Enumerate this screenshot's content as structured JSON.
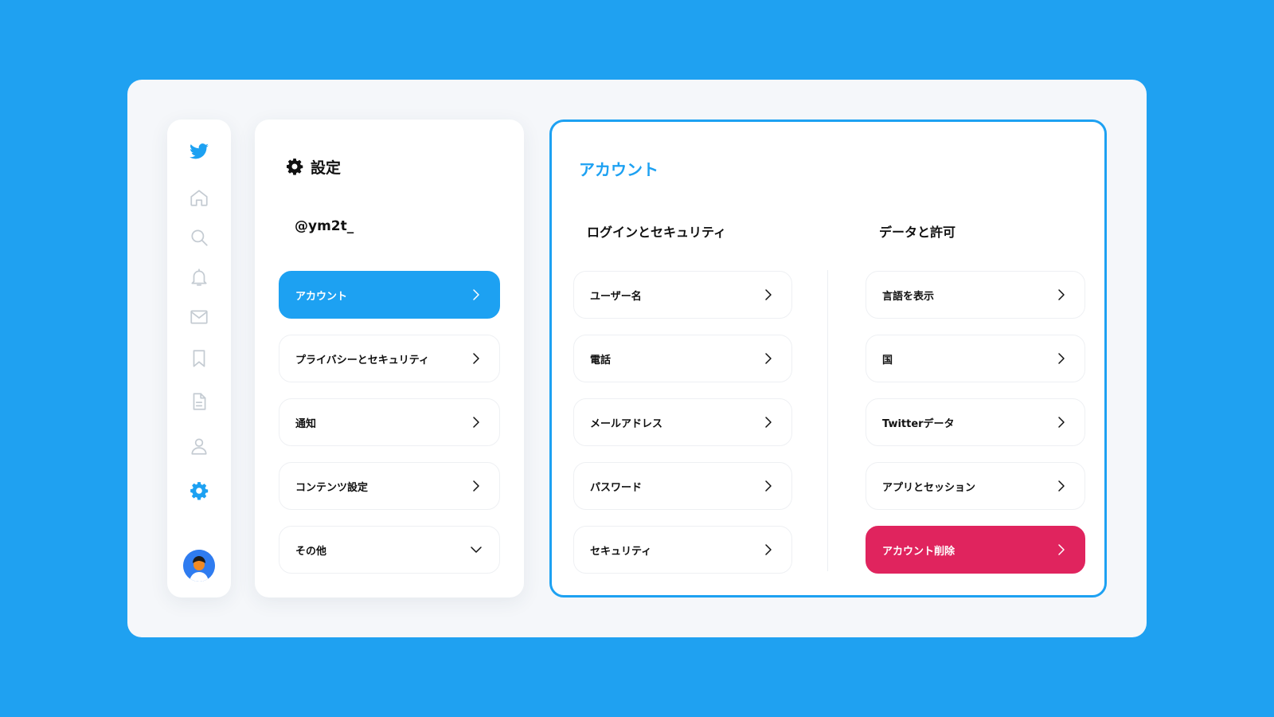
{
  "nav": {
    "logo_icon": "twitter-bird-icon",
    "items": [
      {
        "icon": "home-icon"
      },
      {
        "icon": "search-icon"
      },
      {
        "icon": "bell-icon"
      },
      {
        "icon": "mail-icon"
      },
      {
        "icon": "bookmark-icon"
      },
      {
        "icon": "document-icon"
      },
      {
        "icon": "profile-icon"
      },
      {
        "icon": "gear-icon",
        "active": true
      }
    ],
    "avatar_icon": "avatar"
  },
  "settings": {
    "title": "設定",
    "handle": "@ym2t_",
    "items": [
      {
        "label": "アカウント",
        "active": true
      },
      {
        "label": "プライバシーとセキュリティ"
      },
      {
        "label": "通知"
      },
      {
        "label": "コンテンツ設定"
      },
      {
        "label": "その他",
        "indicator": "chevron-down"
      }
    ]
  },
  "account": {
    "title": "アカウント",
    "login_security": {
      "heading": "ログインとセキュリティ",
      "items": [
        {
          "label": "ユーザー名"
        },
        {
          "label": "電話"
        },
        {
          "label": "メールアドレス"
        },
        {
          "label": "パスワード"
        },
        {
          "label": "セキュリティ"
        }
      ]
    },
    "data_permissions": {
      "heading": "データと許可",
      "items": [
        {
          "label": "言語を表示"
        },
        {
          "label": "国"
        },
        {
          "label": "Twitterデータ"
        },
        {
          "label": "アプリとセッション"
        },
        {
          "label": "アカウント削除",
          "danger": true
        }
      ]
    }
  },
  "colors": {
    "background": "#1fa1f1",
    "accent": "#1da1f2",
    "danger": "#e0245e"
  }
}
